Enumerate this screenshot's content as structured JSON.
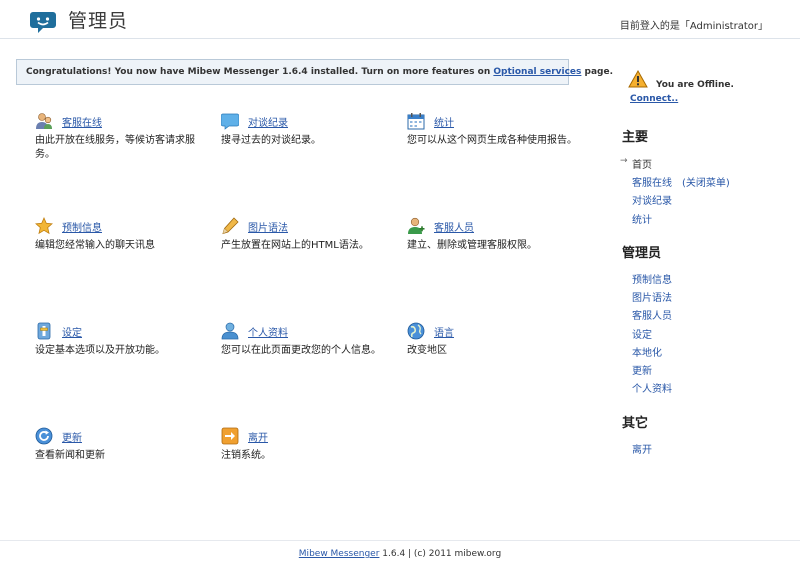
{
  "header": {
    "title": "管理员",
    "user_info": "目前登入的是「Administrator」"
  },
  "notice": {
    "prefix": "Congratulations! You now have Mibew Messenger 1.6.4 installed. Turn on more features on ",
    "link": "Optional services",
    "suffix": " page."
  },
  "items": [
    {
      "title": "客服在线",
      "desc": "由此开放在线服务，等候访客请求服务。",
      "icon": "users-icon"
    },
    {
      "title": "对谈纪录",
      "desc": "搜寻过去的对谈纪录。",
      "icon": "chat-bubble-icon"
    },
    {
      "title": "统计",
      "desc": "您可以从这个网页生成各种使用报告。",
      "icon": "calendar-icon"
    },
    {
      "title": "预制信息",
      "desc": "编辑您经常输入的聊天讯息",
      "icon": "star-icon"
    },
    {
      "title": "图片语法",
      "desc": "产生放置在网站上的HTML语法。",
      "icon": "pencil-icon"
    },
    {
      "title": "客服人员",
      "desc": "建立、删除或管理客服权限。",
      "icon": "user-add-icon"
    },
    {
      "title": "设定",
      "desc": "设定基本选项以及开放功能。",
      "icon": "settings-icon"
    },
    {
      "title": "个人资料",
      "desc": "您可以在此页面更改您的个人信息。",
      "icon": "profile-icon"
    },
    {
      "title": "语言",
      "desc": "改变地区",
      "icon": "globe-icon"
    },
    {
      "title": "更新",
      "desc": "查看新闻和更新",
      "icon": "refresh-icon"
    },
    {
      "title": "离开",
      "desc": "注销系统。",
      "icon": "logout-icon"
    }
  ],
  "sidebar": {
    "status": "You are Offline.",
    "connect": "Connect..",
    "sections": [
      {
        "heading": "主要",
        "items": [
          "首页",
          "客服在线",
          "对谈纪录",
          "统计"
        ],
        "note": "(关闭菜单)"
      },
      {
        "heading": "管理员",
        "items": [
          "预制信息",
          "图片语法",
          "客服人员",
          "设定",
          "本地化",
          "更新",
          "个人资料"
        ]
      },
      {
        "heading": "其它",
        "items": [
          "离开"
        ]
      }
    ]
  },
  "footer": {
    "product": "Mibew Messenger",
    "rest": " 1.6.4 | (c) 2011 mibew.org"
  },
  "colors": {
    "link": "#2a58a8",
    "notice_bg": "#eef3f8",
    "notice_border": "#b9c9d8"
  }
}
